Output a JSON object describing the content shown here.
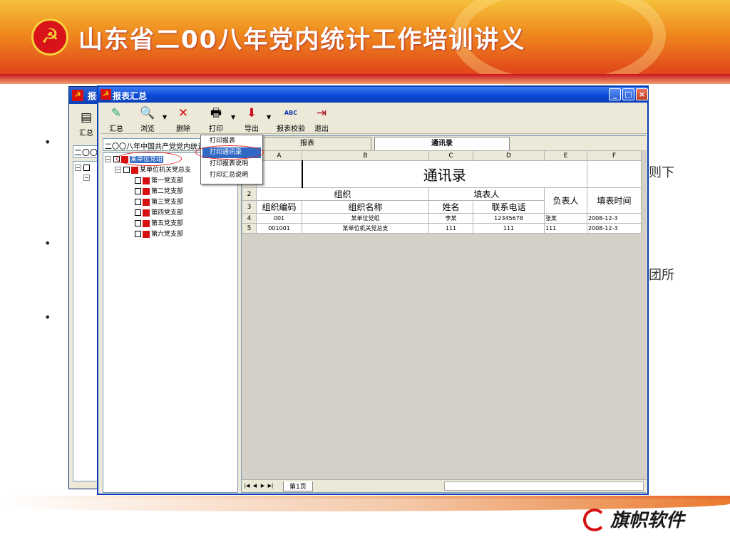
{
  "slide": {
    "title": "山东省二00八年党内统计工作培训讲义",
    "bullets": [
      "•",
      "•",
      "•"
    ],
    "right_fragments": [
      "则下",
      "团所"
    ],
    "brand": "旗帜软件"
  },
  "back_window": {
    "title": "报表",
    "toolbar_label": "汇总",
    "combo": "二〇〇"
  },
  "window": {
    "title": "报表汇总",
    "controls": {
      "minimize": "_",
      "maximize": "□",
      "close": "×"
    },
    "toolbar": [
      {
        "name": "summary",
        "label": "汇总",
        "icon": "summary-icon"
      },
      {
        "name": "browse",
        "label": "浏览",
        "icon": "browse-icon"
      },
      {
        "name": "delete",
        "label": "删除",
        "icon": "delete-icon"
      },
      {
        "name": "print",
        "label": "打印",
        "icon": "print-icon"
      },
      {
        "name": "export",
        "label": "导出",
        "icon": "export-icon"
      },
      {
        "name": "verify",
        "label": "报表校验",
        "icon": "verify-icon"
      },
      {
        "name": "exit",
        "label": "退出",
        "icon": "exit-icon"
      }
    ],
    "combo_value": "二〇〇八年中国共产党党内统计年",
    "tree": [
      {
        "label": "某单位党组",
        "selected": true
      },
      {
        "label": "某单位机关党总支"
      },
      {
        "label": "第一党支部"
      },
      {
        "label": "第二党支部"
      },
      {
        "label": "第三党支部"
      },
      {
        "label": "第四党支部"
      },
      {
        "label": "第五党支部"
      },
      {
        "label": "第六党支部"
      }
    ],
    "print_menu": [
      "打印报表",
      "打印通讯录",
      "打印报表说明",
      "打印汇总说明"
    ],
    "tabs": [
      "报表",
      "通讯录"
    ],
    "sheet": {
      "columns": [
        "A",
        "B",
        "C",
        "D",
        "E",
        "F"
      ],
      "title": "通讯录",
      "header1": {
        "org": "组织",
        "filler": "填表人",
        "manager": "负表人",
        "fill_time": "填表时间"
      },
      "header2": {
        "org_code": "组织编码",
        "org_name": "组织名称",
        "name": "姓名",
        "phone": "联系电话"
      },
      "rows": [
        {
          "num": "4",
          "code": "001",
          "org": "某单位党组",
          "name": "李某",
          "phone": "12345678",
          "manager": "张某",
          "time": "2008-12-3"
        },
        {
          "num": "5",
          "code": "001001",
          "org": "某单位机关党总支",
          "name": "111",
          "phone": "111",
          "manager": "111",
          "time": "2008-12-3"
        }
      ],
      "row_labels": [
        "1",
        "2",
        "3"
      ],
      "sheet_tab": "第1页"
    }
  }
}
